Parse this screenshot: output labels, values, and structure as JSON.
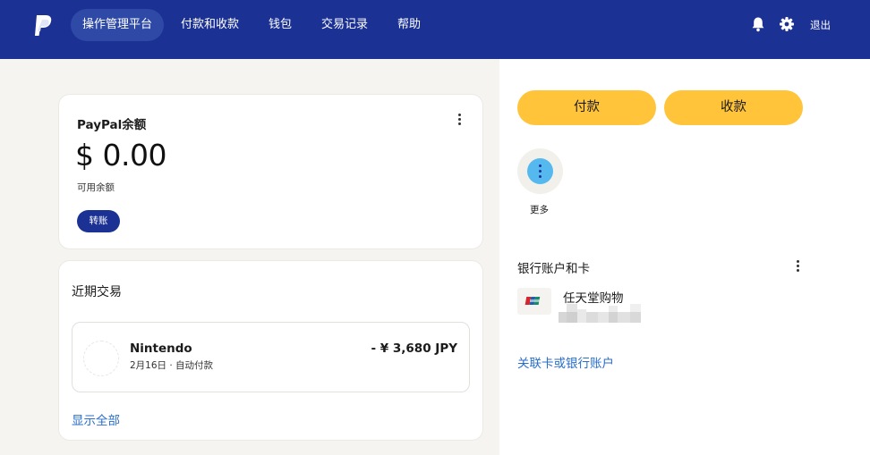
{
  "brand": {
    "logo_icon": "paypal-logo-icon"
  },
  "nav": {
    "items": [
      {
        "label": "操作管理平台",
        "active": true
      },
      {
        "label": "付款和收款"
      },
      {
        "label": "钱包"
      },
      {
        "label": "交易记录"
      },
      {
        "label": "帮助"
      }
    ],
    "notifications_icon": "bell-icon",
    "settings_icon": "gear-icon",
    "logout_label": "退出"
  },
  "balance": {
    "title": "PayPal余额",
    "amount": "$ 0.00",
    "subtitle": "可用余额",
    "transfer_label": "转账",
    "menu_icon": "kebab-icon"
  },
  "recent": {
    "title": "近期交易",
    "transactions": [
      {
        "merchant": "Nintendo",
        "meta": "2月16日 · 自动付款",
        "amount": "- ¥ 3,680 JPY"
      }
    ],
    "show_all_label": "显示全部"
  },
  "actions": {
    "pay_label": "付款",
    "receive_label": "收款",
    "more_label": "更多",
    "more_icon": "more-dots-icon"
  },
  "banks": {
    "title": "银行账户和卡",
    "menu_icon": "kebab-icon",
    "cards": [
      {
        "name": "任天堂购物",
        "card_icon": "unionpay-card-icon"
      }
    ],
    "link_label": "关联卡或银行账户"
  },
  "colors": {
    "header": "#1b3194",
    "accent_yellow": "#ffc43a",
    "link_blue": "#2a6ec9",
    "page_bg": "#f5f4f0"
  }
}
